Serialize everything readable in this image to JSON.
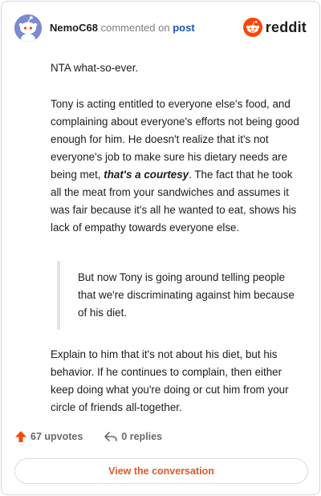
{
  "comment": {
    "username": "NemoC68",
    "commented_on": "commented on",
    "post_link": "post",
    "brand": "reddit",
    "paragraphs": {
      "p1": "NTA what-so-ever.",
      "p2_before": "Tony is acting entitled to everyone else's food, and complaining about everyone's efforts not being good enough for him. He doesn't realize that it's not everyone's job to make sure his dietary needs are being met, ",
      "p2_emphasis": "that's a courtesy",
      "p2_after": ". The fact that he took all the meat from your sandwiches and assumes it was fair because it's all he wanted to eat, shows his lack of empathy towards everyone else.",
      "quote": "But now Tony is going around telling people that we're discriminating against him because of his diet.",
      "p3": "Explain to him that it's not about his diet, but his behavior. If he continues to complain, then either keep doing what you're doing or cut him from your circle of friends all-together."
    },
    "upvotes": "67 upvotes",
    "replies": "0 replies",
    "cta": "View the conversation",
    "colors": {
      "accent": "#e0592a",
      "upvote": "#ff4500",
      "link": "#1a56b6",
      "avatar_bg": "#7b8bd0"
    }
  }
}
